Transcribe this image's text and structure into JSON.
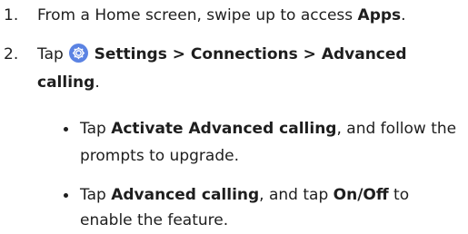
{
  "colors": {
    "text": "#1e1e1e",
    "settings_icon_bg": "#5b83e3",
    "settings_icon_fg": "#ffffff"
  },
  "steps": [
    {
      "number": "1.",
      "prefix": "From a Home screen, swipe up to access ",
      "bold": "Apps",
      "suffix": "."
    },
    {
      "number": "2.",
      "line1_prefix": "Tap ",
      "icon": "settings-gear-icon",
      "line1_bold": "Settings > Connections > Advanced",
      "line2_bold": "calling",
      "line2_suffix": "."
    }
  ],
  "bullets": [
    {
      "line1_prefix": "Tap ",
      "line1_bold": "Activate Advanced calling",
      "line1_suffix": ", and follow the",
      "line2": "prompts to upgrade."
    },
    {
      "line1_prefix": "Tap ",
      "line1_bold": "Advanced calling",
      "line1_mid": ", and tap ",
      "line1_bold2": "On/Off",
      "line1_suffix": " to",
      "line2": "enable the feature."
    }
  ]
}
